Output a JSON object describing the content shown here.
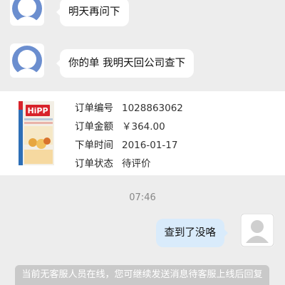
{
  "messages": [
    {
      "side": "in",
      "text": "明天再问下"
    },
    {
      "side": "in",
      "text": "你的单  我明天回公司查下"
    },
    {
      "side": "out",
      "text": "查到了没咯"
    }
  ],
  "order": {
    "product_image": "hipp-baby-cereal-box",
    "rows": [
      {
        "label": "订单编号",
        "value": "1028863062"
      },
      {
        "label": "订单金额",
        "value": "￥364.00"
      },
      {
        "label": "下单时间",
        "value": "2016-01-17"
      },
      {
        "label": "订单状态",
        "value": "待评价"
      }
    ],
    "product_label": "HiPP"
  },
  "timestamp": "07:46",
  "notice": "当前无客服人员在线，您可继续发送消息待客服上线后回复",
  "colors": {
    "background": "#ededed",
    "bubble_in": "#ffffff",
    "bubble_out": "#d9ebfb",
    "avatar_agent": "#6b8ecf",
    "notice_bg": "#c9c9c9",
    "hipp_red": "#d8232a"
  }
}
